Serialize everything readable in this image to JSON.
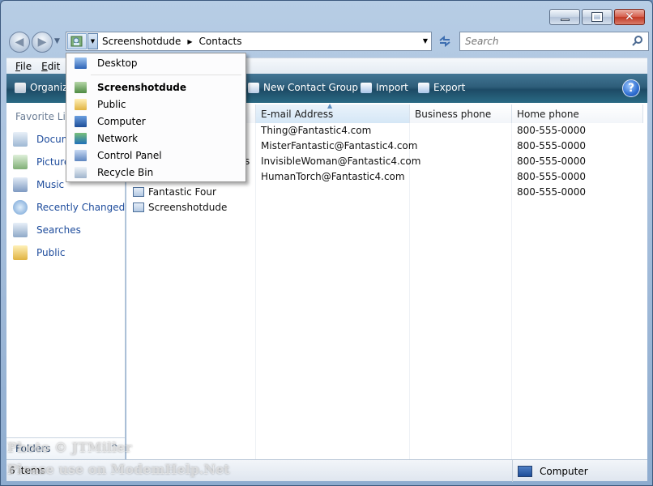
{
  "address": {
    "crumbs": [
      "Screenshotdude",
      "Contacts"
    ]
  },
  "search": {
    "placeholder": "Search"
  },
  "menubar": {
    "file": "F",
    "file_rest": "ile",
    "edit": "E",
    "edit_rest": "dit"
  },
  "toolbar": {
    "organize": "Organiz",
    "new_contact_group": "New Contact Group",
    "import": "Import",
    "export": "Export",
    "help": "?"
  },
  "navpane": {
    "heading": "Favorite Lin",
    "items": [
      "Docum",
      "Picture",
      "Music",
      "Recently Changed",
      "Searches",
      "Public"
    ],
    "folders": "Folders"
  },
  "columns": [
    "E-mail Address",
    "Business phone",
    "Home phone"
  ],
  "rows": [
    {
      "name": "",
      "email": "Thing@Fantastic4.com",
      "business": "",
      "home": "800-555-0000"
    },
    {
      "name": "",
      "email": "MisterFantastic@Fantastic4.com",
      "business": "",
      "home": "800-555-0000"
    },
    {
      "name": "s",
      "email": "InvisibleWoman@Fantastic4.com",
      "business": "",
      "home": "800-555-0000"
    },
    {
      "name": "",
      "email": "HumanTorch@Fantastic4.com",
      "business": "",
      "home": "800-555-0000"
    },
    {
      "name": "Fantastic Four",
      "email": "",
      "business": "",
      "home": "800-555-0000"
    },
    {
      "name": "Screenshotdude",
      "email": "",
      "business": "",
      "home": ""
    }
  ],
  "status": {
    "items": "6 items",
    "computer": "Computer"
  },
  "dropdown": {
    "items": [
      "Desktop",
      "Screenshotdude",
      "Public",
      "Computer",
      "Network",
      "Control Panel",
      "Recycle Bin"
    ]
  },
  "watermark": {
    "line1": "Photo © JTMiller",
    "line2": "Please use on ModemHelp.Net"
  }
}
